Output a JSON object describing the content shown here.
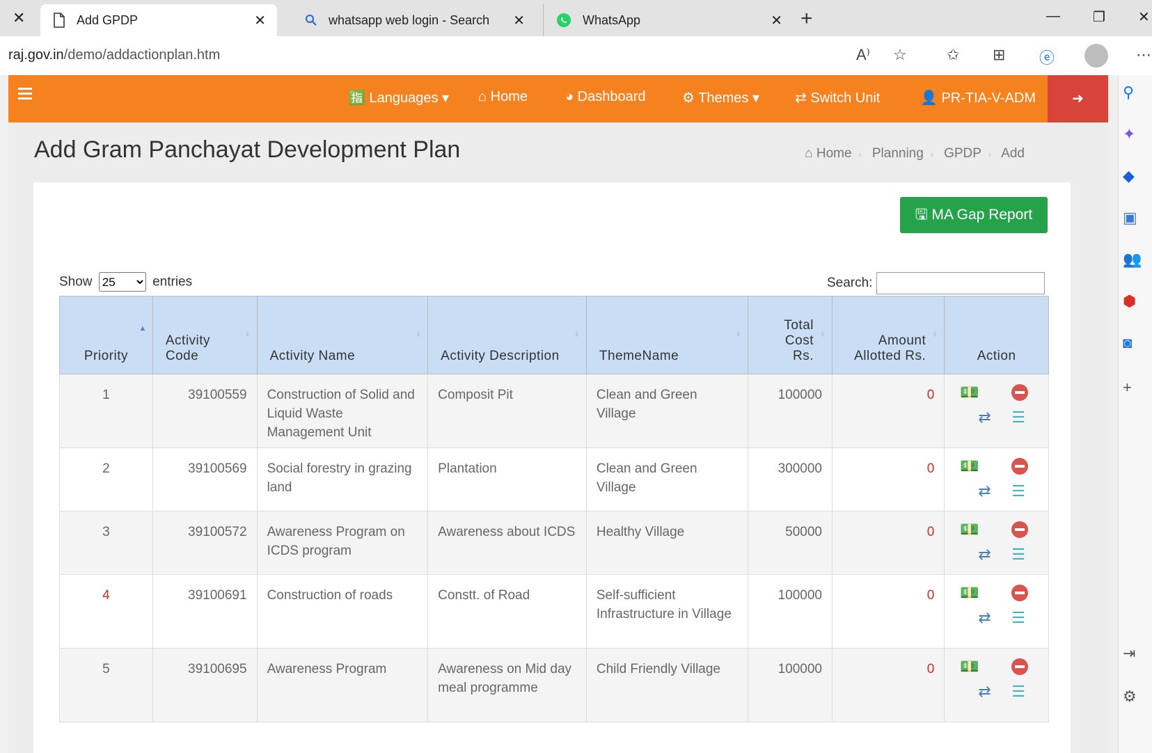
{
  "browser": {
    "tabs": [
      {
        "title": "Add GPDP",
        "icon": "page-icon"
      },
      {
        "title": "whatsapp web login - Search",
        "icon": "search-icon"
      },
      {
        "title": "WhatsApp",
        "icon": "whatsapp-icon"
      }
    ],
    "url_prefix": "raj.gov.in",
    "url_path": "/demo/addactionplan.htm"
  },
  "nav": {
    "items": [
      "Languages",
      "Home",
      "Dashboard",
      "Themes",
      "Switch Unit",
      "PR-TIA-V-ADM"
    ]
  },
  "page": {
    "title": "Add Gram Panchayat Development Plan",
    "breadcrumb": [
      "Home",
      "Planning",
      "GPDP",
      "Add"
    ],
    "gap_button": "MA Gap Report",
    "show_label": "Show",
    "entries_label": "entries",
    "page_length": "25",
    "search_label": "Search:"
  },
  "table": {
    "headers": [
      "Priority",
      "Activity Code",
      "Activity Name",
      "Activity Description",
      "ThemeName",
      "Total Cost Rs.",
      "Amount Allotted Rs.",
      "Action"
    ],
    "rows": [
      {
        "priority": "1",
        "code": "39100559",
        "name": "Construction of Solid and Liquid Waste Management Unit",
        "desc": "Composit Pit",
        "theme": "Clean and Green Village",
        "cost": "100000",
        "allotted": "0"
      },
      {
        "priority": "2",
        "code": "39100569",
        "name": "Social forestry in grazing land",
        "desc": "Plantation",
        "theme": "Clean and Green Village",
        "cost": "300000",
        "allotted": "0"
      },
      {
        "priority": "3",
        "code": "39100572",
        "name": "Awareness Program on ICDS program",
        "desc": "Awareness about ICDS",
        "theme": "Healthy Village",
        "cost": "50000",
        "allotted": "0"
      },
      {
        "priority": "4",
        "code": "39100691",
        "name": "Construction of roads",
        "desc": "Constt. of Road",
        "theme": "Self-sufficient Infrastructure in Village",
        "cost": "100000",
        "allotted": "0"
      },
      {
        "priority": "5",
        "code": "39100695",
        "name": "Awareness Program",
        "desc": "Awareness on Mid day meal programme",
        "theme": "Child Friendly Village",
        "cost": "100000",
        "allotted": "0"
      }
    ]
  },
  "colors": {
    "accent": "#f5821f",
    "logout": "#d9443a",
    "button": "#24a34a",
    "header": "#c9def4"
  }
}
